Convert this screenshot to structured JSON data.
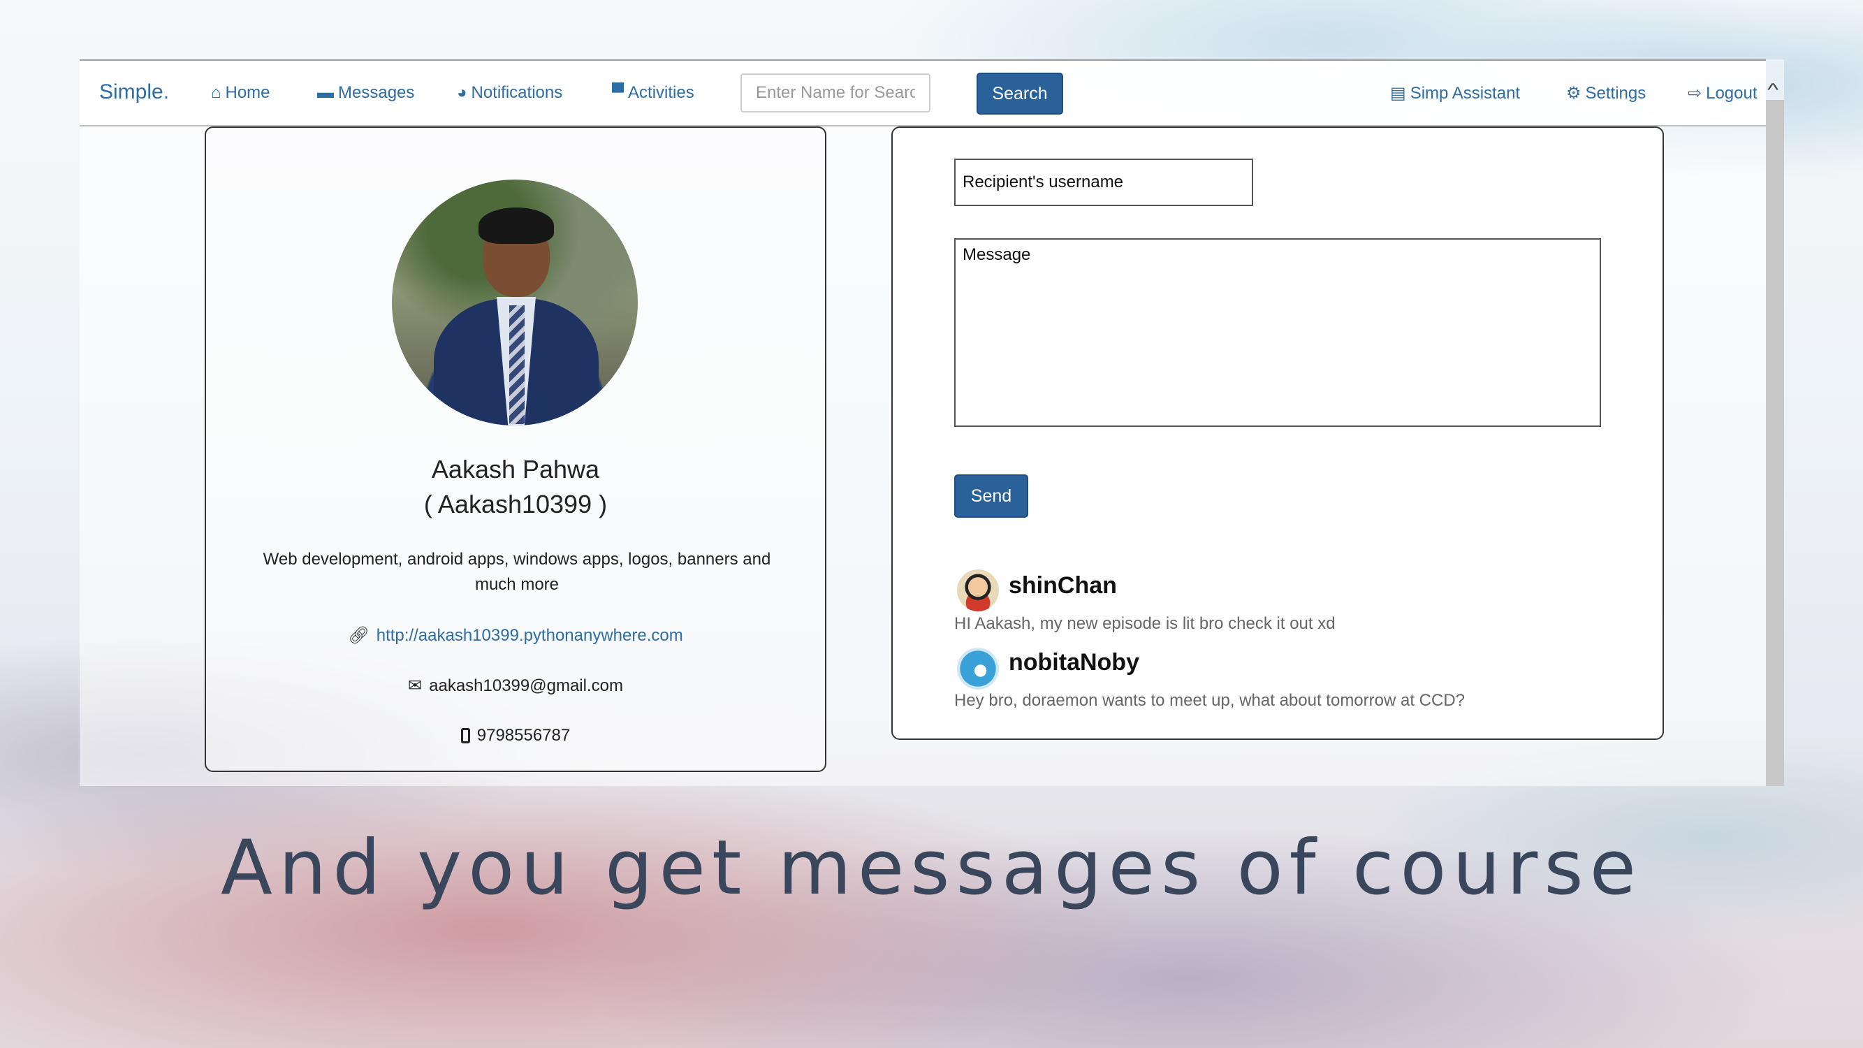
{
  "navbar": {
    "brand": "Simple.",
    "links": [
      {
        "label": "Home",
        "icon": "home-icon"
      },
      {
        "label": "Messages",
        "icon": "comment-icon"
      },
      {
        "label": "Notifications",
        "icon": "globe-icon"
      },
      {
        "label": "Activities",
        "icon": "computer-icon"
      }
    ],
    "search": {
      "placeholder": "Enter Name for Search",
      "button_label": "Search"
    },
    "right_links": [
      {
        "label": "Simp Assistant",
        "icon": "list-icon"
      },
      {
        "label": "Settings",
        "icon": "gear-icon"
      },
      {
        "label": "Logout",
        "icon": "logout-icon"
      }
    ]
  },
  "profile": {
    "name": "Aakash Pahwa",
    "username": "( Aakash10399 )",
    "bio": "Web development, android apps, windows apps, logos, banners and much more",
    "website": "http://aakash10399.pythonanywhere.com",
    "email": "aakash10399@gmail.com",
    "phone": "9798556787"
  },
  "compose": {
    "recipient_placeholder": "Recipient's username",
    "message_placeholder": "Message",
    "send_label": "Send"
  },
  "messages": [
    {
      "sender": "shinChan",
      "text": "HI Aakash, my new episode is lit bro check it out xd"
    },
    {
      "sender": "nobitaNoby",
      "text": "Hey bro, doraemon wants to meet up, what about tomorrow at CCD?"
    }
  ],
  "caption": "And you get messages of course",
  "colors": {
    "accent": "#2e6da4",
    "button": "#2a6198",
    "caption": "#39465c"
  }
}
